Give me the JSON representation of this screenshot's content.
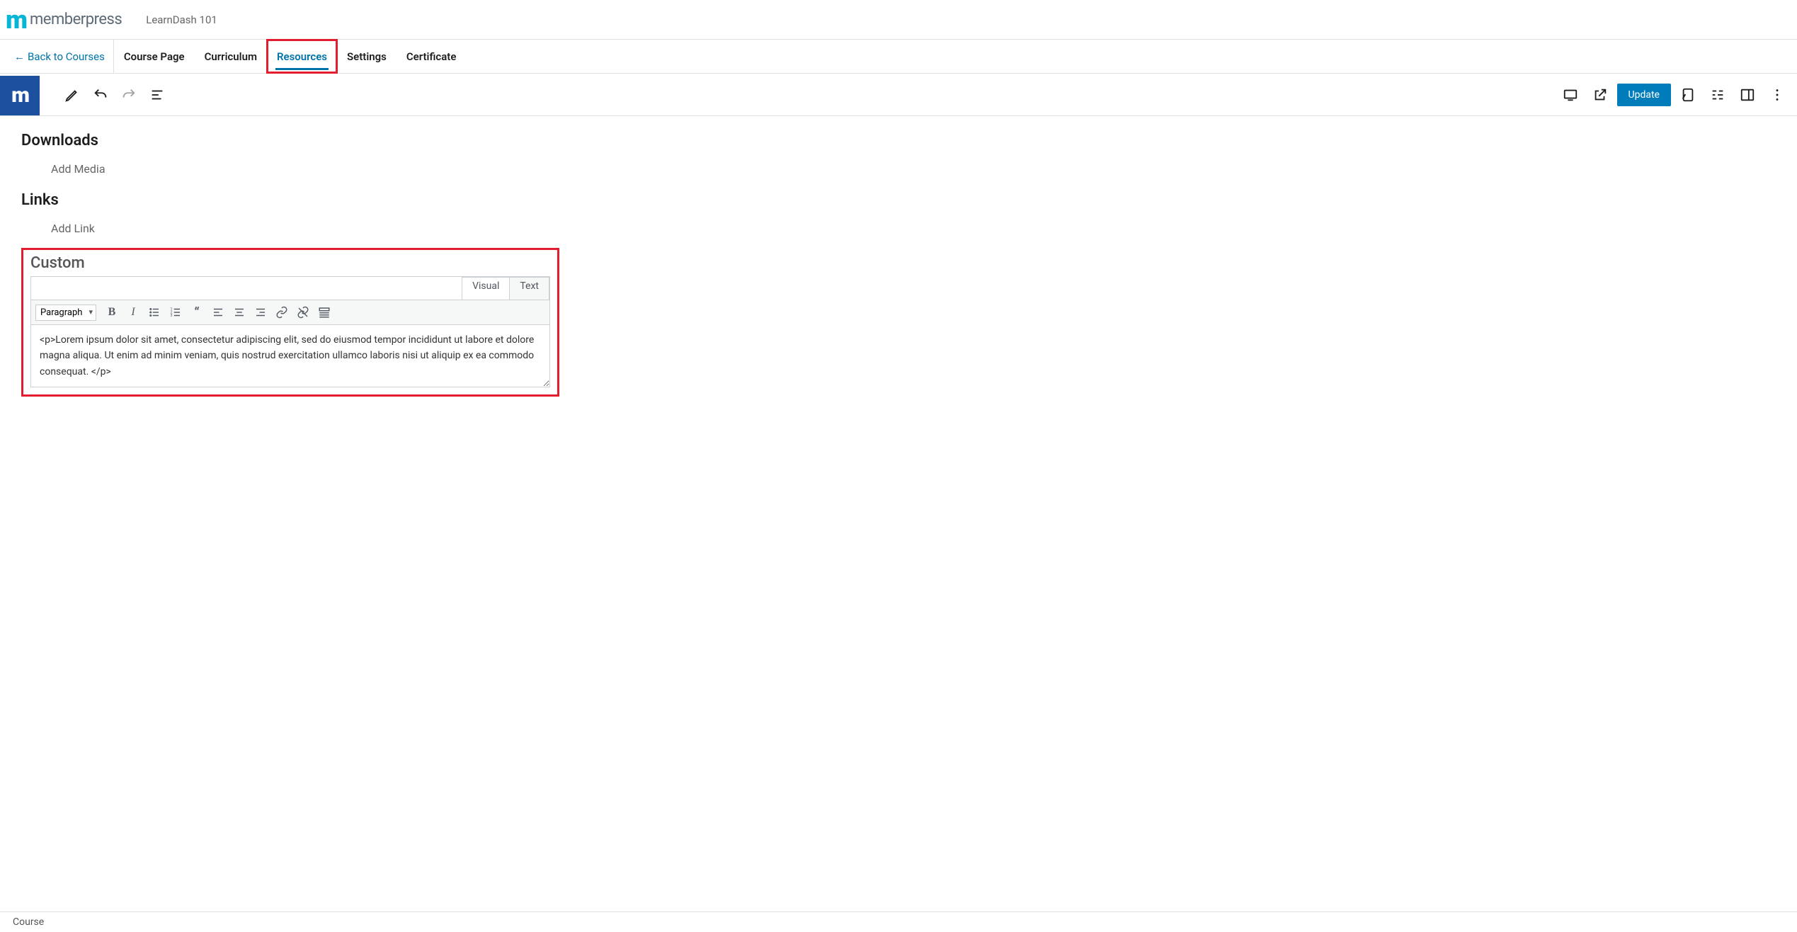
{
  "brand": {
    "name": "memberpress",
    "course_title": "LearnDash 101"
  },
  "nav": {
    "back_label": "Back to Courses",
    "tabs": [
      {
        "label": "Course Page"
      },
      {
        "label": "Curriculum"
      },
      {
        "label": "Resources"
      },
      {
        "label": "Settings"
      },
      {
        "label": "Certificate"
      }
    ]
  },
  "editorbar": {
    "update_label": "Update"
  },
  "sections": {
    "downloads": {
      "heading": "Downloads",
      "action": "Add Media"
    },
    "links": {
      "heading": "Links",
      "action": "Add Link"
    },
    "custom": {
      "heading": "Custom"
    }
  },
  "wpeditor": {
    "tabs": {
      "visual": "Visual",
      "text": "Text"
    },
    "format_option": "Paragraph",
    "content": "<p>Lorem ipsum dolor sit amet, consectetur adipiscing elit, sed do eiusmod tempor incididunt ut labore et dolore magna aliqua. Ut enim ad minim veniam, quis nostrud exercitation ullamco laboris nisi ut aliquip ex ea commodo consequat. </p>"
  },
  "footer": {
    "breadcrumb": "Course"
  },
  "colors": {
    "accent": "#0073aa",
    "highlight": "#e11d2e",
    "brand_cyan": "#06b6d4",
    "brand_blue": "#1e50a0"
  }
}
